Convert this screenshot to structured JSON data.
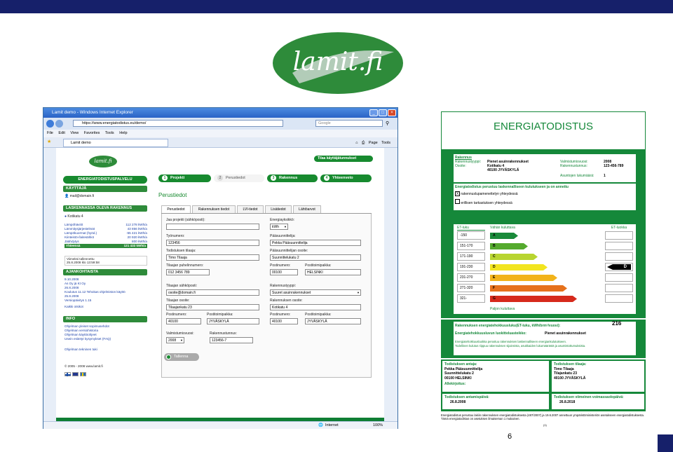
{
  "logo": {
    "text": "lamit.fi"
  },
  "slide_number": "6",
  "browser": {
    "title": "Lamit demo - Windows Internet Explorer",
    "url": "https://www.energiatodistus.eu/demo/",
    "search_placeholder": "Google",
    "menu": [
      "File",
      "Edit",
      "View",
      "Favorites",
      "Tools",
      "Help"
    ],
    "tab": "Lamit demo",
    "toolbar": [
      "Page",
      "Tools"
    ],
    "status_zone": "Internet",
    "zoom": "100%"
  },
  "app": {
    "badge": "lamit.fi",
    "brand": "ENERGIATODISTUSPALVELU",
    "order_button": "Tilaa käyttäjätunnukset",
    "user_header": "KÄYTTÄJÄ",
    "user_email": "mail@domain.fi",
    "building_header": "LASKENNASSA OLEVA RAKENNUS",
    "building_name": "Kotikatu 4",
    "energy_items": [
      {
        "label": "Lämpöhäviöt",
        "value": "112 278",
        "unit": "kWh/a"
      },
      {
        "label": "Lämmitysjärjestelmät",
        "value": "43 856",
        "unit": "kWh/a"
      },
      {
        "label": "Lämpökuormat (hyöd.)",
        "value": "-55 421",
        "unit": "kWh/a"
      },
      {
        "label": "Kiinteistö-/laitesähkö",
        "value": "20 920",
        "unit": "kWh/a"
      },
      {
        "label": "Jäähdytys",
        "value": "800",
        "unit": "kWh/a"
      }
    ],
    "total_label": "Yhteensä",
    "total_value": "121 433",
    "total_unit": "kWh/a",
    "saved_label": "Viimeksi tallennettu",
    "saved_value": "25.8.2008 klo 13:59:58",
    "news_header": "AJANKOHTAISTA",
    "news": [
      "9.10.2008",
      "As Oy jä Kt Oy",
      "26.8.2008",
      "Koulutus 11.12 Tehokas ohjelmiston käyttö",
      "25.8.2008",
      "Versiopäivitys 1.15"
    ],
    "news_all": "Kaikki otsikot",
    "info_header": "INFO",
    "info_links": [
      "Ohjelman yleiset sopimusehdot",
      "Ohjelman versiohistoria",
      "Ohjelman käyttöohjeet",
      "Usein esitetyt kysymykset (FAQ)"
    ],
    "support_link": "Ohjelman tekninen tuki",
    "footer_copy": "© 2005 - 2008 www.lamit.fi",
    "steps": [
      {
        "num": "1",
        "label": "Projekti"
      },
      {
        "num": "2",
        "label": "Perustiedot"
      },
      {
        "num": "3",
        "label": "Rakennus"
      },
      {
        "num": "4",
        "label": "Yhteenveto"
      }
    ],
    "page_title": "Perustiedot",
    "tabs": [
      "Perustiedot",
      "Rakennuksen tiedot",
      "LVI-tiedot",
      "Lisätiedot",
      "Lähtöarvot"
    ],
    "fields": {
      "project_label": "Jaa projekti (sähköposti):",
      "unit_label": "Energiayksikkö:",
      "unit_value": "kWh",
      "client_label": "Työnumero:",
      "client_value": "123456",
      "designer_label": "Pääsuunnittelija:",
      "designer_value": "Pekka Pääsuunnittelija",
      "orderer_label": "Todistuksen tilaaja:",
      "orderer_value": "Timo Tilaaja",
      "designer_addr_label": "Pääsuunnittelijan osoite:",
      "designer_addr_value": "Suunnittelukatu 2",
      "phone_label": "Tilaajan puhelinnumero:",
      "phone_value": "012 3456 789",
      "dpost_label": "Postinumero:",
      "dpost_value": "00100",
      "dcity_label": "Postitoimipaikka:",
      "dcity_value": "HELSINKI",
      "email_label": "Tilaajan sähköposti:",
      "email_value": "osoite@domain.fi",
      "type_label": "Rakennustyyppi:",
      "type_value": "Suuret asuinrakennukset",
      "oaddr_label": "Tilaajan osoite:",
      "oaddr_value": "Tilaajankatu 23",
      "baddr_label": "Rakennuksen osoite:",
      "baddr_value": "Kotikatu 4",
      "opost_label": "Postinumero:",
      "opost_value": "40100",
      "ocity_label": "Postitoimipaikka:",
      "ocity_value": "JYVÄSKYLÄ",
      "bpost_label": "Postinumero:",
      "bpost_value": "40100",
      "bcity_label": "Postitoimipaikka:",
      "bcity_value": "JYVÄSKYLÄ",
      "year_label": "Valmistumisvuosi:",
      "year_value": "2008",
      "bid_label": "Rakennustunnus:",
      "bid_value": "123456-7"
    },
    "save_button": "Tallenna"
  },
  "certificate": {
    "title": "ENERGIATODISTUS",
    "section": "Rakennus",
    "type_label": "Rakennustyyppi:",
    "type_value": "Pienet asuinrakennukset",
    "addr_label": "Osoite:",
    "addr_value_1": "Kotikatu 4",
    "addr_value_2": "40100 JYVÄSKYLÄ",
    "year_label": "Valmistumisvuosi:",
    "year_value": "2008",
    "bid_label": "Rakennustunnus:",
    "bid_value": "123-456-789",
    "apts_label": "Asuntojen lukumäärä:",
    "apts_value": "1",
    "basis_title": "Energiatodistus perustuu laskennalliseen kulutukseen ja on annettu",
    "check1_mark": "X",
    "check1": "rakennuslupamenettelyn yhteydessä",
    "check2": "erillisen tarkastuksen yhteydessä",
    "et_header": "ET-luku",
    "less_label": "Vähän kuluttava",
    "more_label": "Paljon kuluttava",
    "bclass_header_1": "Rakennuksen",
    "bclass_header_2": "ET-luokka",
    "classes": [
      {
        "range": "-150",
        "letter": "A",
        "color": "#1a8a3a"
      },
      {
        "range": "151-170",
        "letter": "B",
        "color": "#55aa2e"
      },
      {
        "range": "171-190",
        "letter": "C",
        "color": "#b8d530"
      },
      {
        "range": "191-230",
        "letter": "D",
        "color": "#f2e51f"
      },
      {
        "range": "231-270",
        "letter": "E",
        "color": "#f2b31a"
      },
      {
        "range": "271-320",
        "letter": "F",
        "color": "#e6711c"
      },
      {
        "range": "321-",
        "letter": "G",
        "color": "#d62a1c"
      }
    ],
    "current_class": "D",
    "et_value_label": "Rakennuksen energiatehokkuusluku(ET-luku, kWh/brm²/vuosi):",
    "et_value": "216",
    "compare_label": "Energiatehokkuusluvun luokitteluasteikko:",
    "compare_value": "Pienet asuinrakennukset",
    "note_1": "Energiatehokkuusluokka perustuu rakennuksen laskennalliseen energiankulutukseen.",
    "note_2": "Todellinen kulutus riippuu rakennuksen sijainnista, asukkaiden lukumäärästä ja asumistottumuksista.",
    "issuer_label": "Todistuksen antaja:",
    "issuer_lines": [
      "Pekka Pääsuunnittelija",
      "Suunnittelukatu 2",
      "00100 HELSINKI"
    ],
    "orderer_label": "Todistuksen tilaaja:",
    "orderer_lines": [
      "Timo Tilaaja",
      "Tilajankatu 23",
      "40100 JYVÄSKYLÄ"
    ],
    "signature_label": "Allekirjoitus:",
    "date_label": "Todistuksen antamispäivä:",
    "date_value": "26.8.2008",
    "valid_label": "Todistuksen viimeinen voimassaolopäivä:",
    "valid_value": "26.8.2018",
    "footer": "Energiatodistus perustuu lakiin rakennuksen energiatodistuksesta (487/2007) ja 19.6.2007 annettuun ympäristöministeriön asetukseen energiatodistuksesta. Tämä energiatodistus on asetuksen ilmaiseman 1 mukainen.",
    "page": "(1)"
  }
}
